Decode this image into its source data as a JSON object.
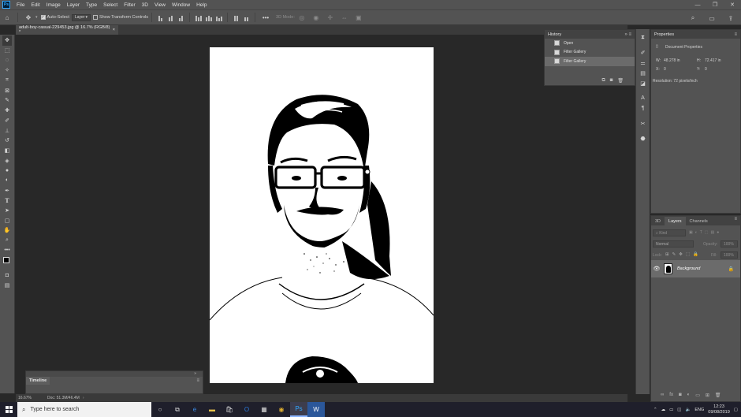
{
  "app": {
    "logo": "Ps"
  },
  "menu": [
    "File",
    "Edit",
    "Image",
    "Layer",
    "Type",
    "Select",
    "Filter",
    "3D",
    "View",
    "Window",
    "Help"
  ],
  "window_controls": {
    "minimize": "—",
    "restore": "❐",
    "close": "✕"
  },
  "options": {
    "auto_select_label": "Auto-Select",
    "auto_select_checked": true,
    "layer_select": "Layer",
    "show_transform_label": "Show Transform Controls",
    "threed_mode_label": "3D Mode:"
  },
  "document": {
    "tab_title": "adult-boy-casual-229453.jpg @ 16.7% (RGB/8) *",
    "close": "×"
  },
  "status": {
    "zoom": "16.67%",
    "doc_size": "Doc: 51.3M/46.4M"
  },
  "timeline": {
    "title": "Timeline"
  },
  "history": {
    "title": "History",
    "items": [
      {
        "label": "Open",
        "selected": false
      },
      {
        "label": "Filter Gallery",
        "selected": false
      },
      {
        "label": "Filter Gallery",
        "selected": true
      }
    ]
  },
  "properties": {
    "title": "Properties",
    "doc_props_label": "Document Properties",
    "w_label": "W:",
    "w_value": "48.278 in",
    "h_label": "H:",
    "h_value": "72.417 in",
    "x_label": "X:",
    "x_value": "0",
    "y_label": "Y:",
    "y_value": "0",
    "resolution": "Resolution: 72 pixels/inch"
  },
  "layers": {
    "tabs": [
      "3D",
      "Layers",
      "Channels"
    ],
    "active_tab": "Layers",
    "kind_placeholder": "Kind",
    "blend_mode": "Normal",
    "opacity_label": "Opacity:",
    "opacity_value": "100%",
    "lock_label": "Lock:",
    "fill_label": "Fill:",
    "fill_value": "100%",
    "items": [
      {
        "name": "Background",
        "visible": true,
        "locked": true
      }
    ]
  },
  "taskbar": {
    "search_placeholder": "Type here to search",
    "language": "ENG",
    "time": "12:23",
    "date": "09/08/2019"
  },
  "colors": {
    "panel": "#535353",
    "canvas_bg": "#282828",
    "selection": "#6b6b6b",
    "accent": "#31a8ff"
  }
}
